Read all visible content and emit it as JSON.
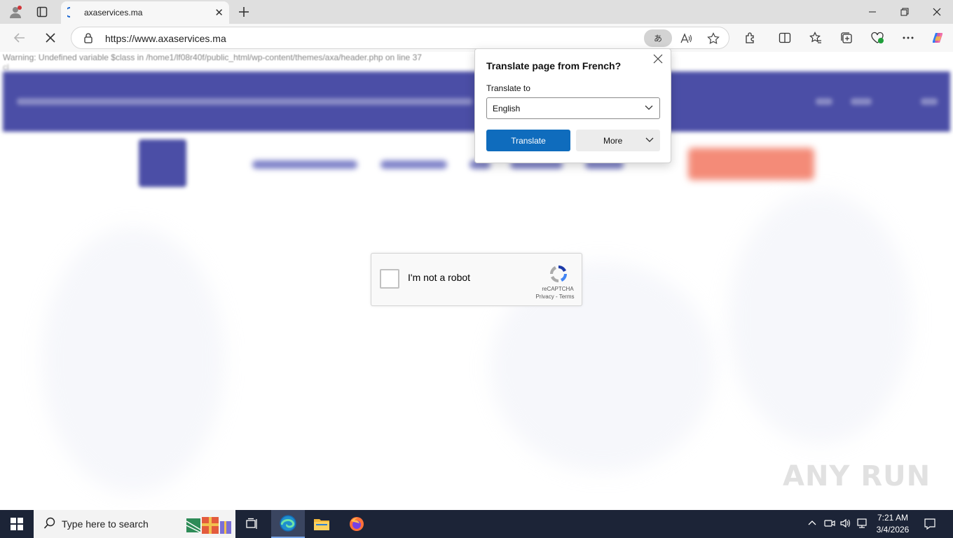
{
  "browser": {
    "tab_title": "axaservices.ma",
    "url": "https://www.axaservices.ma",
    "translate_pill_label": "あ",
    "window_controls": [
      "minimize",
      "restore",
      "close"
    ]
  },
  "page": {
    "warning_line1": "Warning: Undefined variable $class in /home1/lf08r40f/public_html/wp-content/themes/axa/header.php on line 37",
    "warning_line2": "cl",
    "recaptcha": {
      "label": "I'm not a robot",
      "brand": "reCAPTCHA",
      "links": "Privacy - Terms"
    },
    "watermark": "ANY RUN"
  },
  "translate_popup": {
    "title": "Translate page from French?",
    "translate_to_label": "Translate to",
    "selected_language": "English",
    "translate_button": "Translate",
    "more_button": "More"
  },
  "taskbar": {
    "search_placeholder": "Type here to search",
    "time": "7:21 AM",
    "date": "3/4/2026"
  },
  "colors": {
    "translate_button": "#0f6cbd",
    "page_header_blur": "#4b4ea6",
    "cta_blur": "#f48b78",
    "taskbar": "#1c2437"
  }
}
